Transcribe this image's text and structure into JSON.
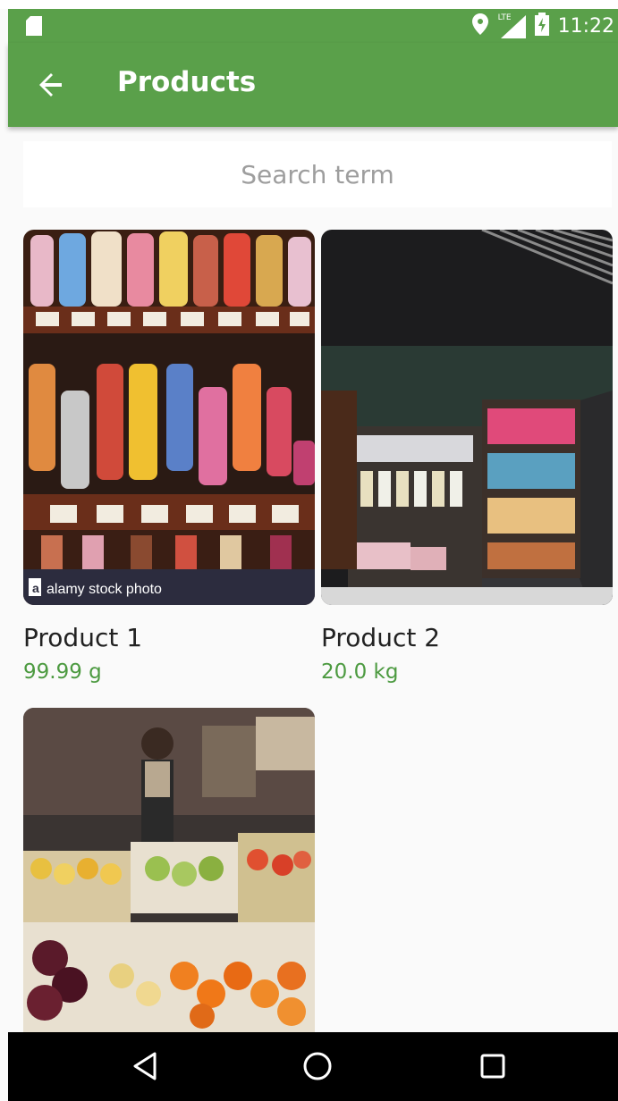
{
  "status_bar": {
    "time": "11:22",
    "network": "LTE",
    "icons": [
      "sd-card-icon",
      "location-icon",
      "signal-icon",
      "battery-charging-icon"
    ]
  },
  "app_bar": {
    "title": "Products",
    "back_icon": "arrow-back-icon"
  },
  "search": {
    "placeholder": "Search term"
  },
  "products": [
    {
      "name": "Product 1",
      "amount": "99.99 g",
      "image": "candy shop shelves with jars",
      "watermark": "alamy stock photo"
    },
    {
      "name": "Product 2",
      "amount": "20.0 kg",
      "image": "store interior with product shelves"
    },
    {
      "name": "",
      "amount": "",
      "image": "fruit market stall with vendor"
    }
  ],
  "nav_bar": {
    "buttons": [
      "back-triangle-icon",
      "home-circle-icon",
      "recents-square-icon"
    ]
  },
  "colors": {
    "accent": "#5aa04a",
    "price": "#4c9a40"
  }
}
